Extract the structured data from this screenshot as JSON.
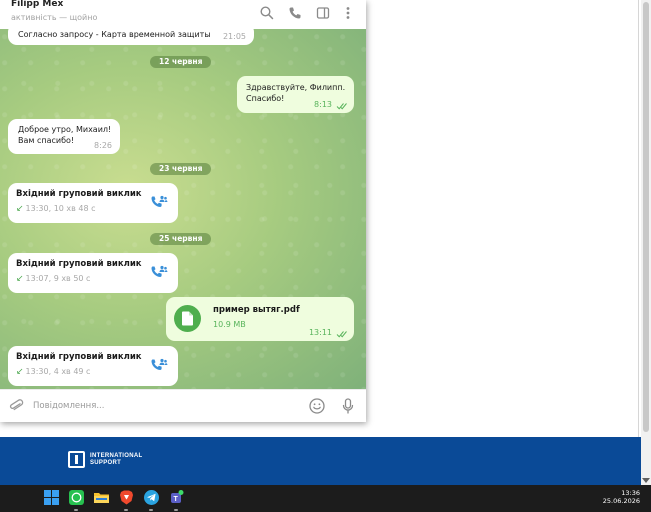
{
  "chat": {
    "name": "Filipp Mex",
    "status": "активність — щойно"
  },
  "messages": {
    "m1_text": "Согласно запросу - Карта временной защиты",
    "m1_time": "21:05",
    "date1": "12 червня",
    "m2_line1": "Здравствуйте, Филипп.",
    "m2_line2": "Спасибо!",
    "m2_time": "8:13",
    "m3_line1": "Доброе утро, Михаил!",
    "m3_line2": "Вам спасибо!",
    "m3_time": "8:26",
    "date2": "23 червня",
    "call1_title": "Вхідний груповий виклик",
    "call1_detail": "13:30, 10 хв 48 с",
    "date3": "25 червня",
    "call2_title": "Вхідний груповий виклик",
    "call2_detail": "13:07, 9 хв 50 с",
    "file_name": "пример вытяг.pdf",
    "file_size": "10.9 MB",
    "file_time": "13:11",
    "call3_title": "Вхідний груповий виклик",
    "call3_detail": "13:30, 4 хв 49 с"
  },
  "composer": {
    "placeholder": "Повідомлення..."
  },
  "footer": {
    "logo_text": "INTERNATIONAL\nSUPPORT"
  },
  "taskbar": {
    "time": "13:36",
    "date": "25.06.2026"
  },
  "icons": {
    "header": [
      "search-icon",
      "phone-icon",
      "sidebar-toggle-icon",
      "more-vertical-icon"
    ],
    "composer": [
      "paperclip-icon",
      "emoji-icon",
      "microphone-icon"
    ],
    "taskbar": [
      "windows-start-icon",
      "whatsapp-icon",
      "file-explorer-icon",
      "brave-browser-icon",
      "telegram-icon",
      "teams-icon"
    ]
  },
  "colors": {
    "accent_green": "#4fae4e",
    "outgoing_bubble": "#effdde",
    "footer_blue": "#0a4a97",
    "call_icon_blue": "#3a8fd8"
  }
}
